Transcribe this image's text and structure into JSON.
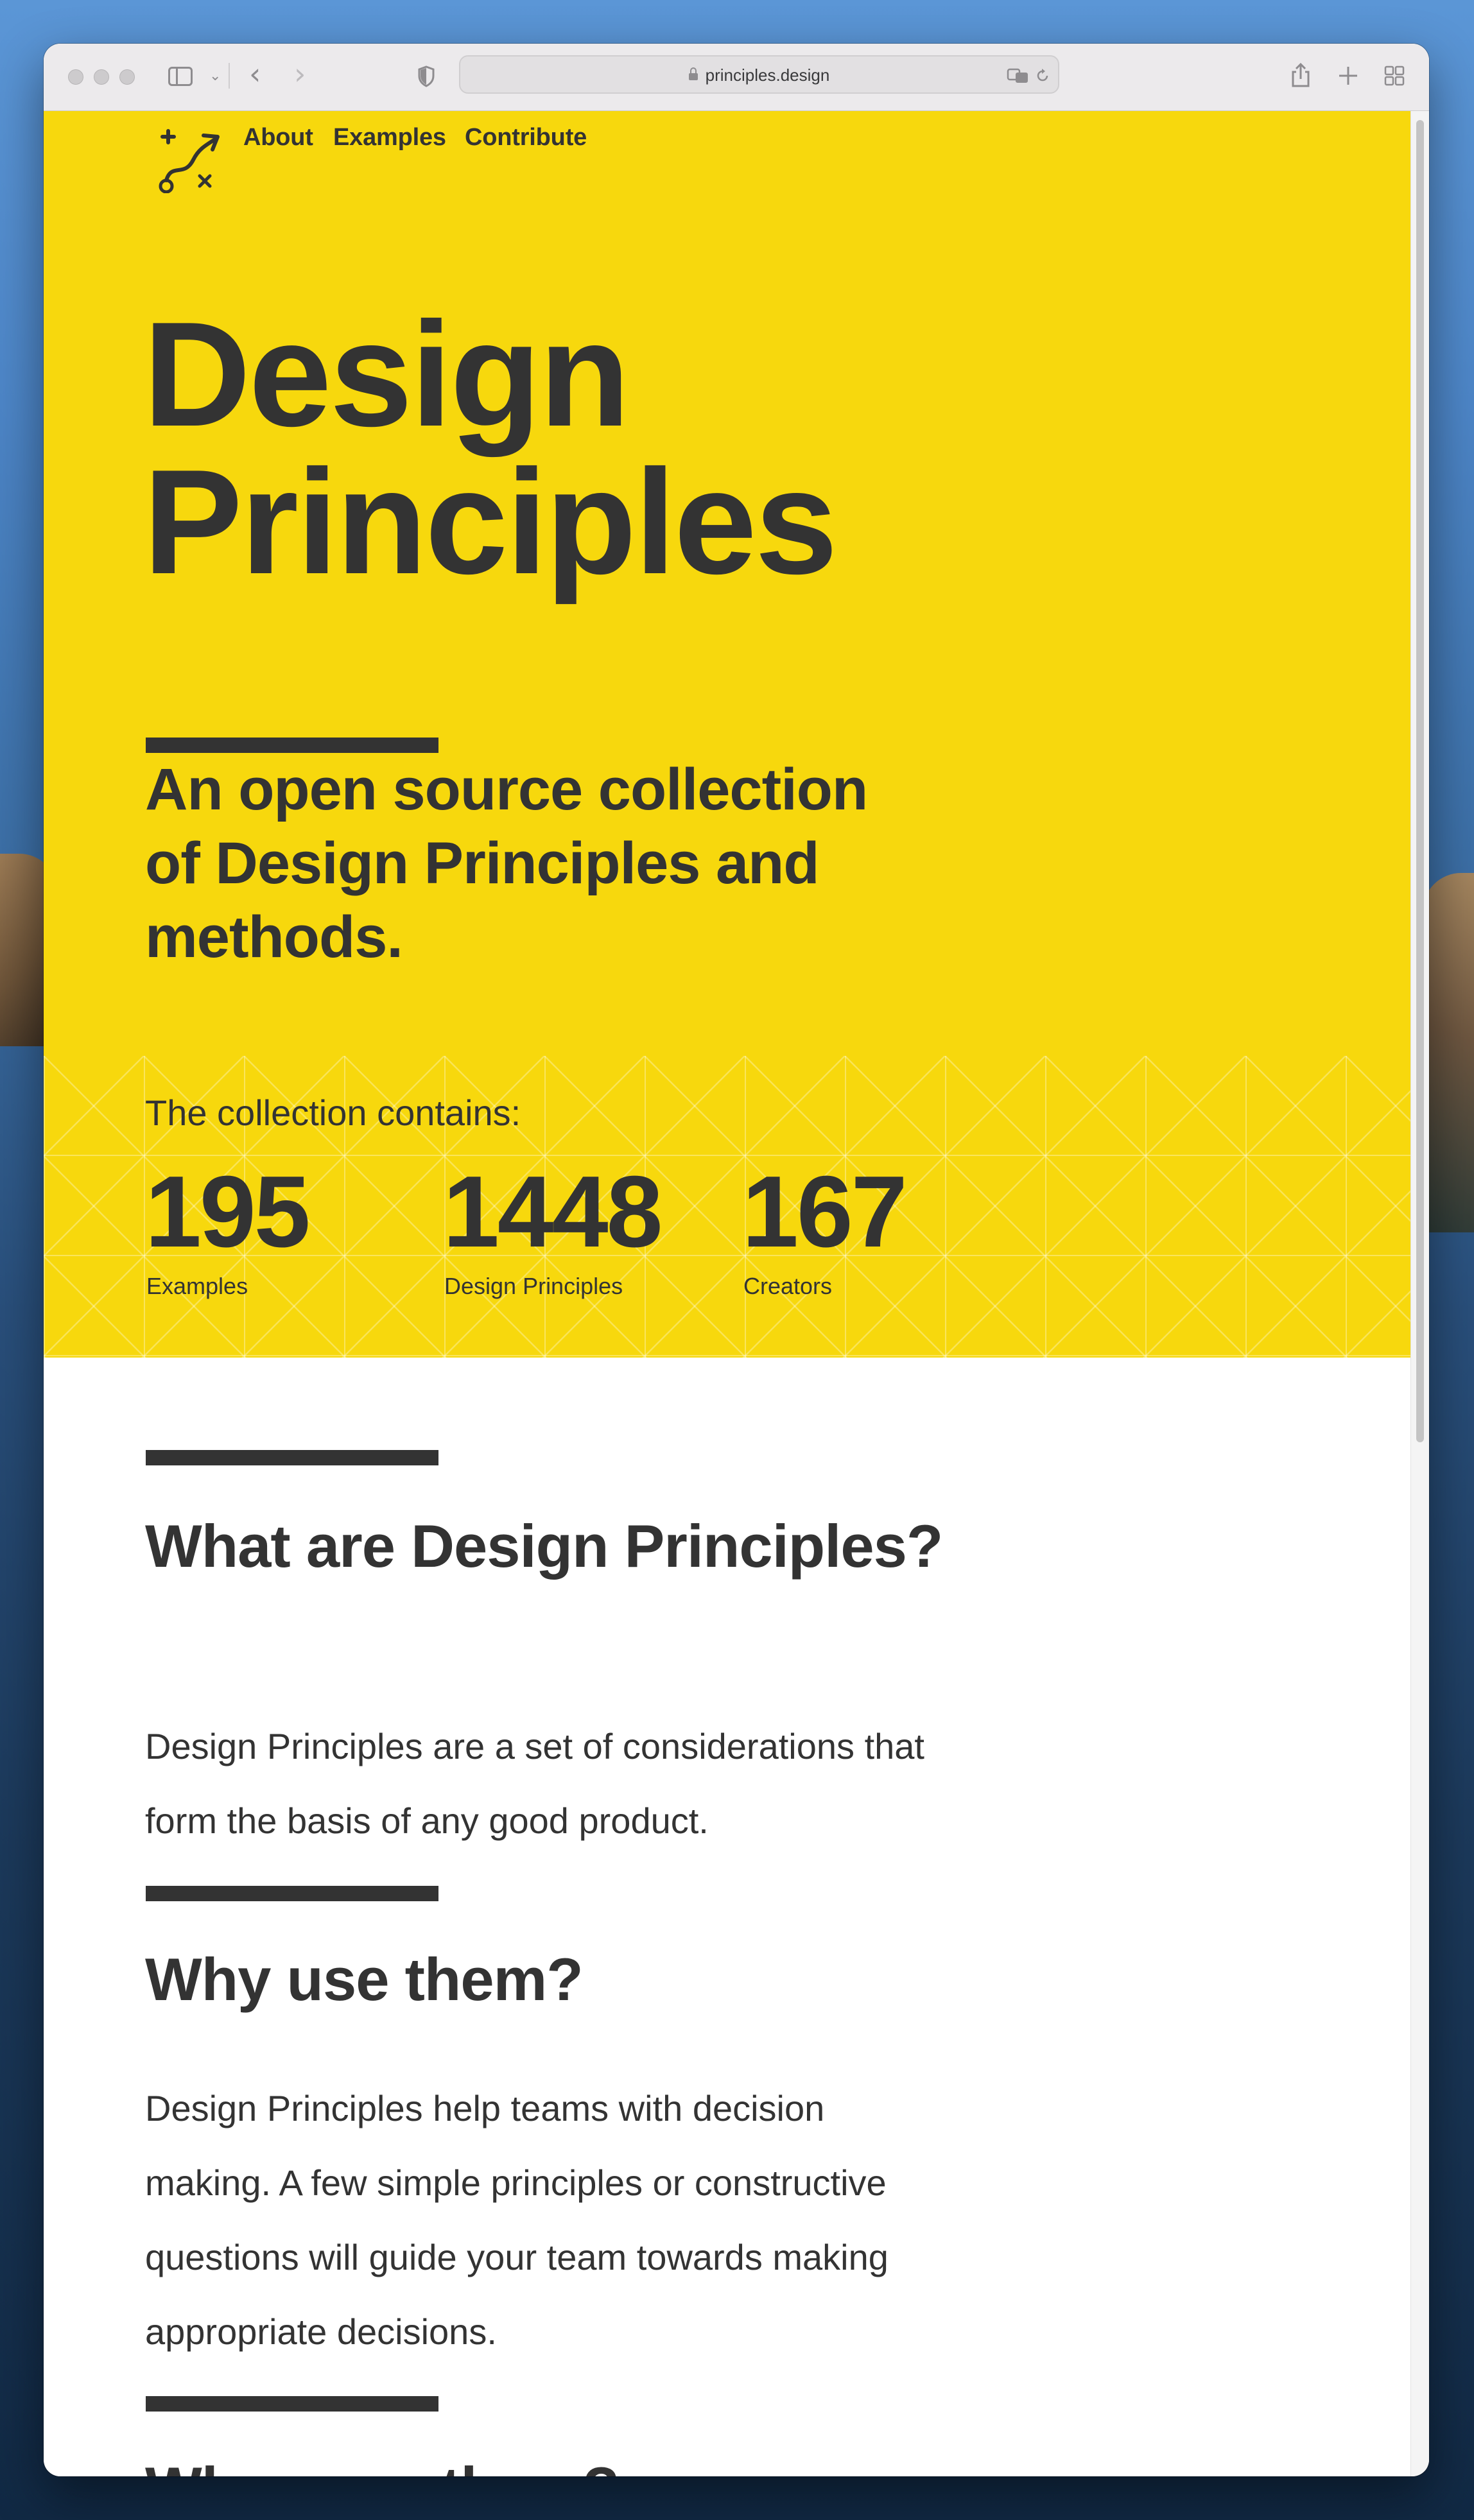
{
  "browser": {
    "url": "principles.design"
  },
  "nav": {
    "about": "About",
    "examples": "Examples",
    "contribute": "Contribute"
  },
  "hero": {
    "title_line1": "Design",
    "title_line2": "Principles",
    "tagline": "An open source collection of Design Principles and methods."
  },
  "stats": {
    "intro": "The collection contains:",
    "items": [
      {
        "value": "195",
        "label": "Examples"
      },
      {
        "value": "1448",
        "label": "Design Principles"
      },
      {
        "value": "167",
        "label": "Creators"
      }
    ]
  },
  "sections": [
    {
      "heading": "What are Design Principles?",
      "body": "Design Principles are a set of considerations that form the basis of any good product."
    },
    {
      "heading": "Why use them?",
      "body": "Design Principles help teams with decision making. A few simple principles or constructive questions will guide your team towards making appropriate decisions."
    },
    {
      "heading": "Who uses them?"
    }
  ],
  "colors": {
    "hero_yellow": "#f7d80d",
    "text_dark": "#333333"
  },
  "icons": {
    "logo": "route-arrow-logo-icon",
    "sidebar": "sidebar-icon",
    "back": "chevron-left-icon",
    "forward": "chevron-right-icon",
    "shield": "privacy-shield-icon",
    "translate": "translate-icon",
    "reload": "reload-icon",
    "share": "share-icon",
    "new_tab": "plus-icon",
    "tab_overview": "tab-grid-icon"
  }
}
